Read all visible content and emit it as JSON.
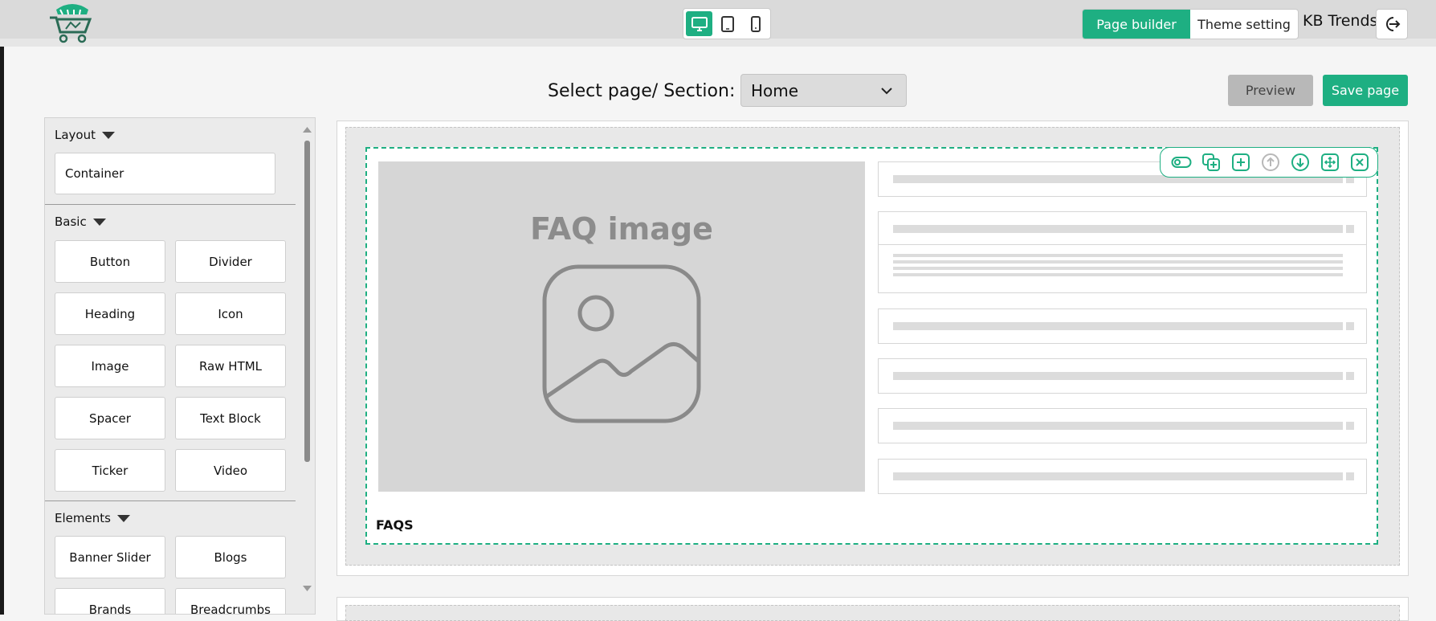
{
  "topbar": {
    "devices": [
      "desktop-icon",
      "tablet-icon",
      "mobile-icon"
    ],
    "active_device": "desktop",
    "tabs": {
      "page_builder": "Page builder",
      "theme_setting": "Theme setting"
    },
    "store_name": "KB Trends"
  },
  "page_select": {
    "label": "Select page/ Section:",
    "value": "Home"
  },
  "actions": {
    "preview": "Preview",
    "save": "Save page"
  },
  "sidebar": {
    "layout": {
      "title": "Layout",
      "items": [
        "Container"
      ]
    },
    "basic": {
      "title": "Basic",
      "items": [
        "Button",
        "Divider",
        "Heading",
        "Icon",
        "Image",
        "Raw HTML",
        "Spacer",
        "Text Block",
        "Ticker",
        "Video"
      ]
    },
    "elements": {
      "title": "Elements",
      "items": [
        "Banner Slider",
        "Blogs",
        "Brands",
        "Breadcrumbs"
      ]
    }
  },
  "canvas": {
    "faq_image_label": "FAQ image",
    "faq_title": "FAQS",
    "toolbar_icons": [
      "toggle-icon",
      "duplicate-icon",
      "add-icon",
      "move-up-icon",
      "move-down-icon",
      "drag-icon",
      "close-icon"
    ]
  },
  "colors": {
    "accent": "#1eaf82",
    "preview_bg": "#b8b8b8",
    "topbar_bg": "#dadada"
  }
}
